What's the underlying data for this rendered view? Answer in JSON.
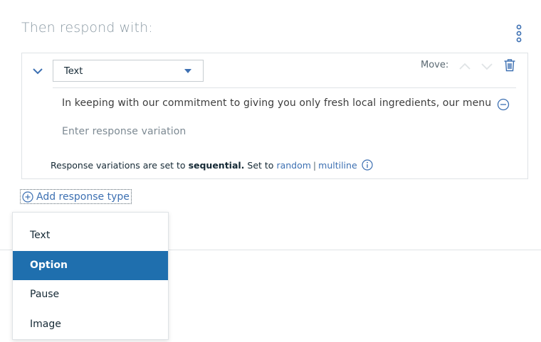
{
  "header": {
    "title": "Then respond with:"
  },
  "response": {
    "type_label": "Text",
    "move_label": "Move:",
    "variations": [
      "In keeping with our commitment to giving you only fresh local ingredients, our menu changes monthly."
    ],
    "variation_placeholder": "Enter response variation",
    "settings": {
      "prefix": "Response variations are set to ",
      "mode": "sequential.",
      "set_to": " Set to ",
      "option_random": "random",
      "separator": "|",
      "option_multiline": "multiline"
    }
  },
  "add_response": {
    "label": "Add response type"
  },
  "menu": {
    "items": [
      "Text",
      "Option",
      "Pause",
      "Image"
    ],
    "selected": "Option"
  },
  "colors": {
    "accent": "#3d70b2",
    "selected_bg": "#1f6fae",
    "muted": "#8c9ba5"
  }
}
